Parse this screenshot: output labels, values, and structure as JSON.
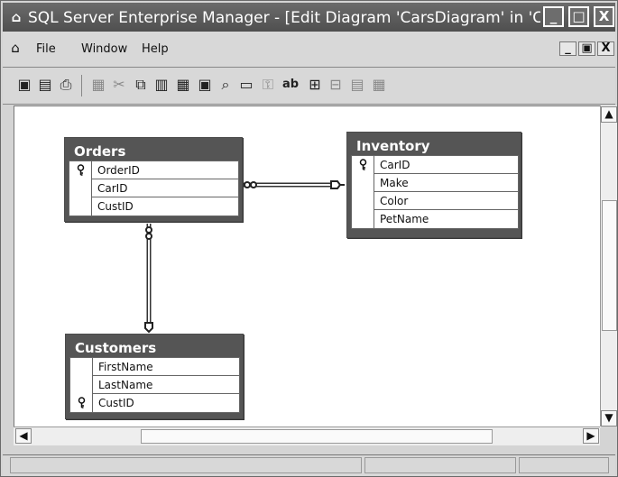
{
  "window": {
    "title": "SQL Server Enterprise Manager - [Edit Diagram 'CarsDiagram' in 'Ca...",
    "minimize_label": "_",
    "maximize_label": "□",
    "close_label": "X"
  },
  "menu": {
    "items": [
      "File",
      "Window",
      "Help"
    ],
    "mdi_minimize": "_",
    "mdi_restore": "▣",
    "mdi_close": "X"
  },
  "toolbar": {
    "icons": [
      "save-icon",
      "properties-icon",
      "print-icon",
      "new-table-icon",
      "cut-icon",
      "copy-icon",
      "paste-icon",
      "delete-table-icon",
      "relationship-icon",
      "zoom-icon",
      "show-icon",
      "key-icon",
      "text-icon",
      "layout-icon",
      "autosize-icon",
      "grid-icon",
      "table-view-icon"
    ],
    "text_label": "ab"
  },
  "tables": {
    "orders": {
      "title": "Orders",
      "fields": [
        "OrderID",
        "CarID",
        "CustID"
      ]
    },
    "inventory": {
      "title": "Inventory",
      "fields": [
        "CarID",
        "Make",
        "Color",
        "PetName"
      ]
    },
    "customers": {
      "title": "Customers",
      "fields": [
        "FirstName",
        "LastName",
        "CustID"
      ]
    }
  },
  "colors": {
    "window_chrome": "#d4d4d4",
    "title_bar": "#5a5a5a",
    "table_header": "#555555",
    "canvas": "#ffffff"
  }
}
